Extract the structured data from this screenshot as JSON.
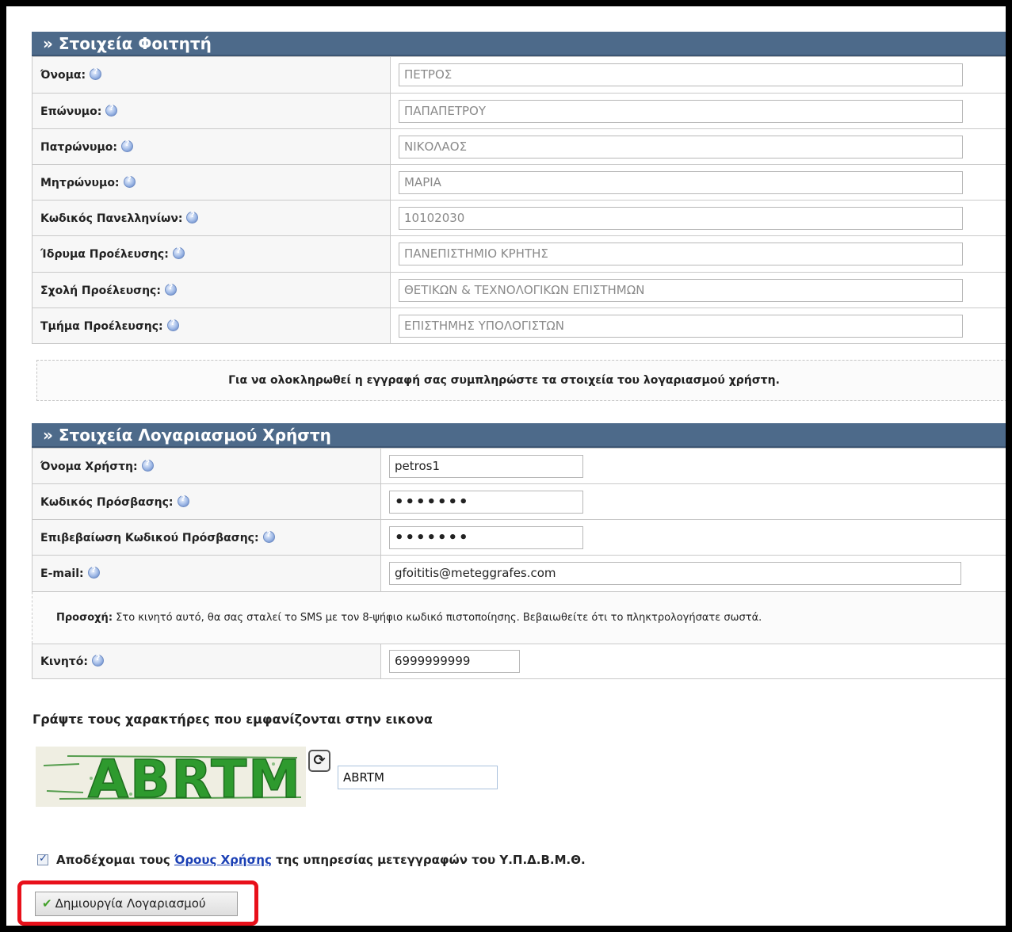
{
  "student_section": {
    "title": "» Στοιχεία Φοιτητή",
    "rows": [
      {
        "label": "Όνομα:",
        "value": "ΠΕΤΡΟΣ"
      },
      {
        "label": "Επώνυμο:",
        "value": "ΠΑΠΑΠΕΤΡΟΥ"
      },
      {
        "label": "Πατρώνυμο:",
        "value": "ΝΙΚΟΛΑΟΣ"
      },
      {
        "label": "Μητρώνυμο:",
        "value": "ΜΑΡΙΑ"
      },
      {
        "label": "Κωδικός Πανελληνίων:",
        "value": "10102030"
      },
      {
        "label": "Ίδρυμα Προέλευσης:",
        "value": "ΠΑΝΕΠΙΣΤΗΜΙΟ ΚΡΗΤΗΣ"
      },
      {
        "label": "Σχολή Προέλευσης:",
        "value": "ΘΕΤΙΚΩΝ & ΤΕΧΝΟΛΟΓΙΚΩΝ ΕΠΙΣΤΗΜΩΝ"
      },
      {
        "label": "Τμήμα Προέλευσης:",
        "value": "ΕΠΙΣΤΗΜΗΣ ΥΠΟΛΟΓΙΣΤΩΝ"
      }
    ]
  },
  "info_message": "Για να ολοκληρωθεί η εγγραφή σας συμπληρώστε τα στοιχεία του λογαριασμού χρήστη.",
  "account_section": {
    "title": "» Στοιχεία Λογαριασμού Χρήστη",
    "username_label": "Όνομα Χρήστη:",
    "username_value": "petros1",
    "password_label": "Κωδικός Πρόσβασης:",
    "password_value": "•••••••",
    "confirm_label": "Επιβεβαίωση Κωδικού Πρόσβασης:",
    "confirm_value": "•••••••",
    "email_label": "E-mail:",
    "email_value": "gfoititis@meteggrafes.com",
    "warning_bold": "Προσοχή:",
    "warning_text": " Στο κινητό αυτό, θα σας σταλεί το SMS με τον 8-ψήφιο κωδικό πιστοποίησης. Βεβαιωθείτε ότι το πληκτρολογήσατε σωστά.",
    "mobile_label": "Κινητό:",
    "mobile_value": "6999999999"
  },
  "captcha": {
    "title": "Γράψτε τους χαρακτήρες που εμφανίζονται στην εικονα",
    "image_text": "ABRTM",
    "input_value": "ABRTM"
  },
  "terms": {
    "prefix": "Αποδέχομαι τους ",
    "link": "Όρους Χρήσης",
    "suffix": " της υπηρεσίας μετεγγραφών του Υ.Π.Δ.Β.Μ.Θ."
  },
  "create_button_label": "Δημιουργία Λογαριασμού",
  "colors": {
    "header_bg": "#4d6a8a",
    "highlight_border": "#e8101a",
    "link": "#1a3fb4"
  }
}
